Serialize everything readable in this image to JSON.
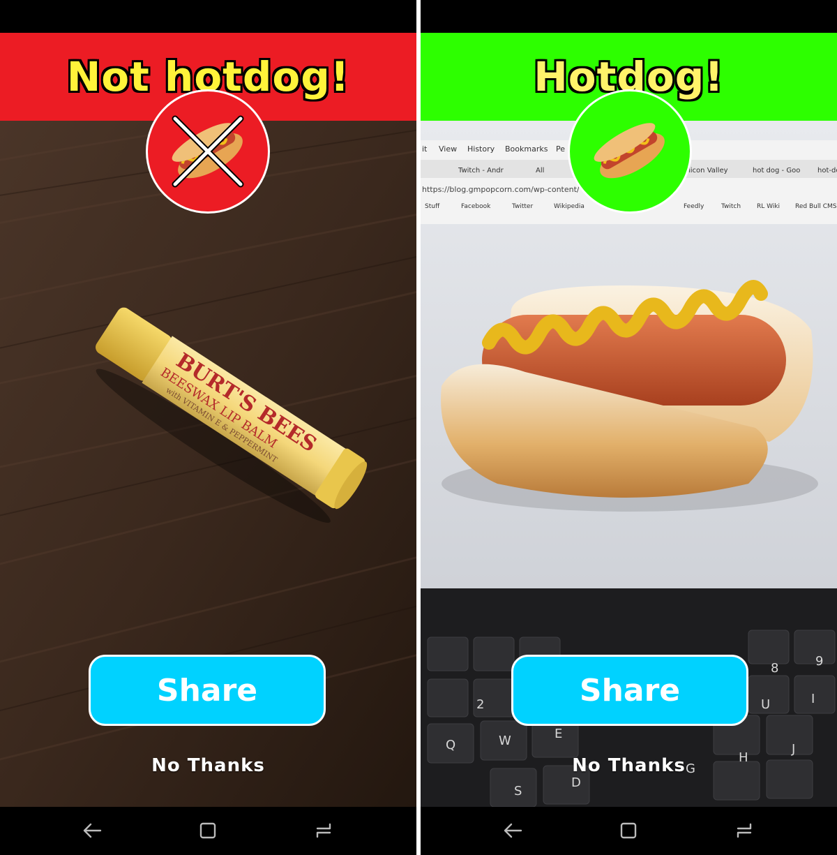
{
  "left_screen": {
    "title": "Not hotdog!",
    "banner_color": "#ec1c24",
    "badge_color": "#ec1c24",
    "badge_icon": "crossed-hotdog-icon",
    "photo": {
      "label_main": "BURT'S BEES",
      "label_sub": "BEESWAX LIP BALM",
      "label_small": "with VITAMIN E & PEPPERMINT"
    },
    "share_label": "Share",
    "no_thanks_label": "No Thanks"
  },
  "right_screen": {
    "title": "Hotdog!",
    "banner_color": "#2dff00",
    "badge_color": "#2dff00",
    "badge_icon": "hotdog-icon",
    "photo": {
      "menu": [
        "it",
        "View",
        "History",
        "Bookmarks",
        "Pe"
      ],
      "tabs": [
        "Twitch - Andr",
        "All",
        "licon Valley",
        "hot dog - Goo",
        "hot-do"
      ],
      "url": "https://blog.gmpopcorn.com/wp-content/",
      "bookmarks": [
        "Stuff",
        "Facebook",
        "Twitter",
        "Wikipedia",
        "Feedly",
        "Twitch",
        "RL Wiki",
        "Red Bull CMS"
      ],
      "keys": [
        "2",
        "Q",
        "W",
        "E",
        "S",
        "D",
        "G",
        "H",
        "J",
        "U",
        "8",
        "9",
        "I"
      ]
    },
    "share_label": "Share",
    "no_thanks_label": "No Thanks"
  },
  "navigation": {
    "back_icon": "back-arrow-icon",
    "home_icon": "home-square-icon",
    "recents_icon": "recents-icon"
  }
}
